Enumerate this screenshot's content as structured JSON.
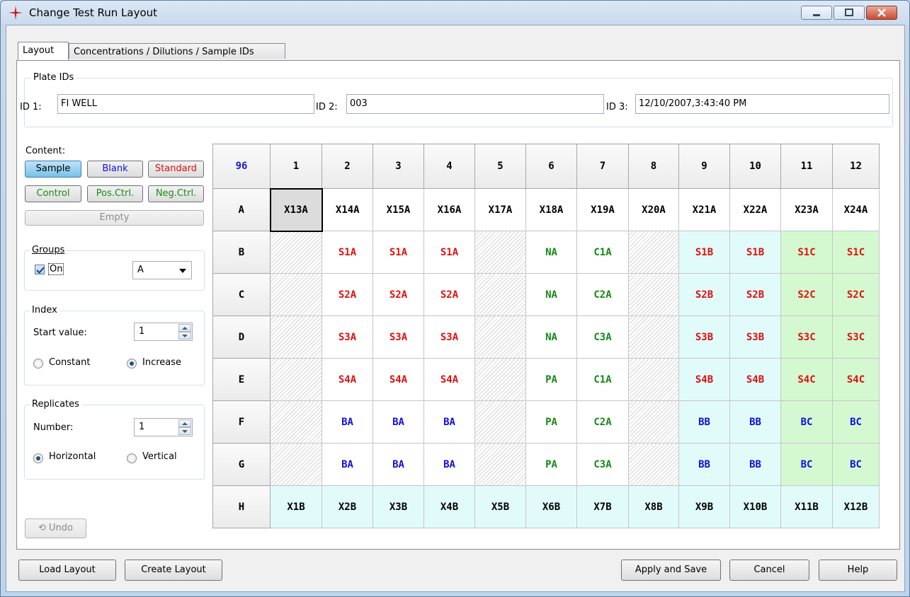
{
  "window": {
    "title": "Change Test Run Layout"
  },
  "tabs": [
    "Layout",
    "Concentrations / Dilutions / Sample IDs"
  ],
  "plate_ids": {
    "group_label": "Plate IDs",
    "id1_label": "ID 1:",
    "id1_value": "FI WELL",
    "id2_label": "ID 2:",
    "id2_value": "003",
    "id3_label": "ID 3:",
    "id3_value": "12/10/2007,3:43:40 PM"
  },
  "content": {
    "label": "Content:",
    "buttons": {
      "sample": "Sample",
      "blank": "Blank",
      "standard": "Standard",
      "control": "Control",
      "pos_ctrl": "Pos.Ctrl.",
      "neg_ctrl": "Neg.Ctrl.",
      "empty": "Empty"
    },
    "colors": {
      "blank": "#1010e0",
      "standard": "#e01010",
      "control": "#168a16"
    }
  },
  "groups": {
    "label": "Groups",
    "on_label": "On",
    "on_checked": true,
    "value": "A"
  },
  "index": {
    "label": "Index",
    "start_label": "Start value:",
    "start_value": "1",
    "constant_label": "Constant",
    "increase_label": "Increase",
    "selected": "Increase"
  },
  "replicates": {
    "label": "Replicates",
    "number_label": "Number:",
    "number_value": "1",
    "horizontal_label": "Horizontal",
    "vertical_label": "Vertical",
    "selected": "Horizontal"
  },
  "undo_label": "Undo",
  "plate": {
    "corner": "96",
    "columns": [
      "1",
      "2",
      "3",
      "4",
      "5",
      "6",
      "7",
      "8",
      "9",
      "10",
      "11",
      "12"
    ],
    "rows": [
      {
        "label": "A",
        "cells": [
          {
            "t": "X13A",
            "c": "black",
            "bg": "sel"
          },
          {
            "t": "X14A",
            "c": "black"
          },
          {
            "t": "X15A",
            "c": "black"
          },
          {
            "t": "X16A",
            "c": "black"
          },
          {
            "t": "X17A",
            "c": "black"
          },
          {
            "t": "X18A",
            "c": "black"
          },
          {
            "t": "X19A",
            "c": "black"
          },
          {
            "t": "X20A",
            "c": "black"
          },
          {
            "t": "X21A",
            "c": "black"
          },
          {
            "t": "X22A",
            "c": "black"
          },
          {
            "t": "X23A",
            "c": "black"
          },
          {
            "t": "X24A",
            "c": "black"
          }
        ]
      },
      {
        "label": "B",
        "cells": [
          {
            "t": "",
            "bg": "hatch"
          },
          {
            "t": "S1A",
            "c": "red"
          },
          {
            "t": "S1A",
            "c": "red"
          },
          {
            "t": "S1A",
            "c": "red"
          },
          {
            "t": "",
            "bg": "hatch"
          },
          {
            "t": "NA",
            "c": "green"
          },
          {
            "t": "C1A",
            "c": "green"
          },
          {
            "t": "",
            "bg": "hatch"
          },
          {
            "t": "S1B",
            "c": "red",
            "bg": "cyan"
          },
          {
            "t": "S1B",
            "c": "red",
            "bg": "cyan"
          },
          {
            "t": "S1C",
            "c": "red",
            "bg": "green"
          },
          {
            "t": "S1C",
            "c": "red",
            "bg": "green"
          }
        ]
      },
      {
        "label": "C",
        "cells": [
          {
            "t": "",
            "bg": "hatch"
          },
          {
            "t": "S2A",
            "c": "red"
          },
          {
            "t": "S2A",
            "c": "red"
          },
          {
            "t": "S2A",
            "c": "red"
          },
          {
            "t": "",
            "bg": "hatch"
          },
          {
            "t": "NA",
            "c": "green"
          },
          {
            "t": "C2A",
            "c": "green"
          },
          {
            "t": "",
            "bg": "hatch"
          },
          {
            "t": "S2B",
            "c": "red",
            "bg": "cyan"
          },
          {
            "t": "S2B",
            "c": "red",
            "bg": "cyan"
          },
          {
            "t": "S2C",
            "c": "red",
            "bg": "green"
          },
          {
            "t": "S2C",
            "c": "red",
            "bg": "green"
          }
        ]
      },
      {
        "label": "D",
        "cells": [
          {
            "t": "",
            "bg": "hatch"
          },
          {
            "t": "S3A",
            "c": "red"
          },
          {
            "t": "S3A",
            "c": "red"
          },
          {
            "t": "S3A",
            "c": "red"
          },
          {
            "t": "",
            "bg": "hatch"
          },
          {
            "t": "NA",
            "c": "green"
          },
          {
            "t": "C3A",
            "c": "green"
          },
          {
            "t": "",
            "bg": "hatch"
          },
          {
            "t": "S3B",
            "c": "red",
            "bg": "cyan"
          },
          {
            "t": "S3B",
            "c": "red",
            "bg": "cyan"
          },
          {
            "t": "S3C",
            "c": "red",
            "bg": "green"
          },
          {
            "t": "S3C",
            "c": "red",
            "bg": "green"
          }
        ]
      },
      {
        "label": "E",
        "cells": [
          {
            "t": "",
            "bg": "hatch"
          },
          {
            "t": "S4A",
            "c": "red"
          },
          {
            "t": "S4A",
            "c": "red"
          },
          {
            "t": "S4A",
            "c": "red"
          },
          {
            "t": "",
            "bg": "hatch"
          },
          {
            "t": "PA",
            "c": "green"
          },
          {
            "t": "C1A",
            "c": "green"
          },
          {
            "t": "",
            "bg": "hatch"
          },
          {
            "t": "S4B",
            "c": "red",
            "bg": "cyan"
          },
          {
            "t": "S4B",
            "c": "red",
            "bg": "cyan"
          },
          {
            "t": "S4C",
            "c": "red",
            "bg": "green"
          },
          {
            "t": "S4C",
            "c": "red",
            "bg": "green"
          }
        ]
      },
      {
        "label": "F",
        "cells": [
          {
            "t": "",
            "bg": "hatch"
          },
          {
            "t": "BA",
            "c": "blue"
          },
          {
            "t": "BA",
            "c": "blue"
          },
          {
            "t": "BA",
            "c": "blue"
          },
          {
            "t": "",
            "bg": "hatch"
          },
          {
            "t": "PA",
            "c": "green"
          },
          {
            "t": "C2A",
            "c": "green"
          },
          {
            "t": "",
            "bg": "hatch"
          },
          {
            "t": "BB",
            "c": "blue",
            "bg": "cyan"
          },
          {
            "t": "BB",
            "c": "blue",
            "bg": "cyan"
          },
          {
            "t": "BC",
            "c": "blue",
            "bg": "green"
          },
          {
            "t": "BC",
            "c": "blue",
            "bg": "green"
          }
        ]
      },
      {
        "label": "G",
        "cells": [
          {
            "t": "",
            "bg": "hatch"
          },
          {
            "t": "BA",
            "c": "blue"
          },
          {
            "t": "BA",
            "c": "blue"
          },
          {
            "t": "BA",
            "c": "blue"
          },
          {
            "t": "",
            "bg": "hatch"
          },
          {
            "t": "PA",
            "c": "green"
          },
          {
            "t": "C3A",
            "c": "green"
          },
          {
            "t": "",
            "bg": "hatch"
          },
          {
            "t": "BB",
            "c": "blue",
            "bg": "cyan"
          },
          {
            "t": "BB",
            "c": "blue",
            "bg": "cyan"
          },
          {
            "t": "BC",
            "c": "blue",
            "bg": "green"
          },
          {
            "t": "BC",
            "c": "blue",
            "bg": "green"
          }
        ]
      },
      {
        "label": "H",
        "cells": [
          {
            "t": "X1B",
            "c": "black",
            "bg": "cyan"
          },
          {
            "t": "X2B",
            "c": "black",
            "bg": "cyan"
          },
          {
            "t": "X3B",
            "c": "black",
            "bg": "cyan"
          },
          {
            "t": "X4B",
            "c": "black",
            "bg": "cyan"
          },
          {
            "t": "X5B",
            "c": "black",
            "bg": "cyan"
          },
          {
            "t": "X6B",
            "c": "black",
            "bg": "cyan"
          },
          {
            "t": "X7B",
            "c": "black",
            "bg": "cyan"
          },
          {
            "t": "X8B",
            "c": "black",
            "bg": "cyan"
          },
          {
            "t": "X9B",
            "c": "black",
            "bg": "cyan"
          },
          {
            "t": "X10B",
            "c": "black",
            "bg": "cyan"
          },
          {
            "t": "X11B",
            "c": "black",
            "bg": "cyan"
          },
          {
            "t": "X12B",
            "c": "black",
            "bg": "cyan"
          }
        ]
      }
    ]
  },
  "footer": {
    "load_layout": "Load Layout",
    "create_layout": "Create Layout",
    "apply_save": "Apply and Save",
    "cancel": "Cancel",
    "help": "Help"
  }
}
